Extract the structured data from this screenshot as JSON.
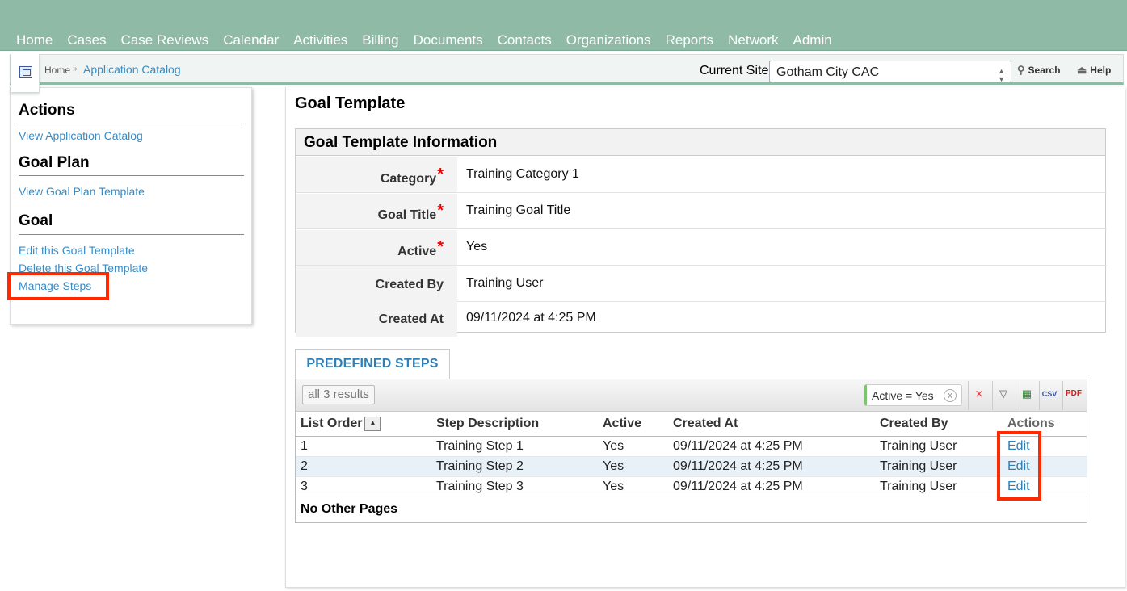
{
  "nav": {
    "items": [
      "Home",
      "Cases",
      "Case Reviews",
      "Calendar",
      "Activities",
      "Billing",
      "Documents",
      "Contacts",
      "Organizations",
      "Reports",
      "Network",
      "Admin"
    ]
  },
  "breadcrumb": {
    "home": "Home",
    "separator": "»",
    "current": "Application Catalog"
  },
  "site": {
    "label": "Current Site",
    "value": "Gotham City CAC"
  },
  "tools": {
    "search": "Search",
    "help": "Help"
  },
  "sidebar": {
    "actions_title": "Actions",
    "view_catalog": "View Application Catalog",
    "goal_plan_title": "Goal Plan",
    "view_goal_plan": "View Goal Plan Template",
    "goal_title": "Goal",
    "edit_goal": "Edit this Goal Template",
    "delete_goal": "Delete this Goal Template",
    "manage_steps": "Manage Steps"
  },
  "main": {
    "title": "Goal Template",
    "info_title": "Goal Template Information",
    "fields": [
      {
        "label": "Category",
        "value": "Training Category 1",
        "required": true
      },
      {
        "label": "Goal Title",
        "value": "Training Goal Title",
        "required": true
      },
      {
        "label": "Active",
        "value": "Yes",
        "required": true
      },
      {
        "label": "Created By",
        "value": "Training User",
        "required": false
      },
      {
        "label": "Created At",
        "value": "09/11/2024 at 4:25 PM",
        "required": false
      }
    ],
    "required_mark": "*",
    "tab_label": "PREDEFINED STEPS",
    "results": "all 3 results",
    "filter_chip": "Active = Yes",
    "filter_clear": "x",
    "columns": [
      "List Order",
      "Step Description",
      "Active",
      "Created At",
      "Created By",
      "Actions"
    ],
    "rows": [
      {
        "order": "1",
        "description": "Training Step 1",
        "active": "Yes",
        "created_at": "09/11/2024 at 4:25 PM",
        "created_by": "Training User",
        "action": "Edit"
      },
      {
        "order": "2",
        "description": "Training Step 2",
        "active": "Yes",
        "created_at": "09/11/2024 at 4:25 PM",
        "created_by": "Training User",
        "action": "Edit"
      },
      {
        "order": "3",
        "description": "Training Step 3",
        "active": "Yes",
        "created_at": "09/11/2024 at 4:25 PM",
        "created_by": "Training User",
        "action": "Edit"
      }
    ],
    "pagination": "No Other Pages",
    "toolbar_icons": [
      "clear-filter-icon",
      "filter-icon",
      "excel-export-icon",
      "csv-export-icon",
      "pdf-export-icon"
    ]
  },
  "colors": {
    "nav_bg": "#8fbba6",
    "link": "#3a8bc2",
    "highlight": "#ff2a00",
    "required": "#ee0000"
  }
}
